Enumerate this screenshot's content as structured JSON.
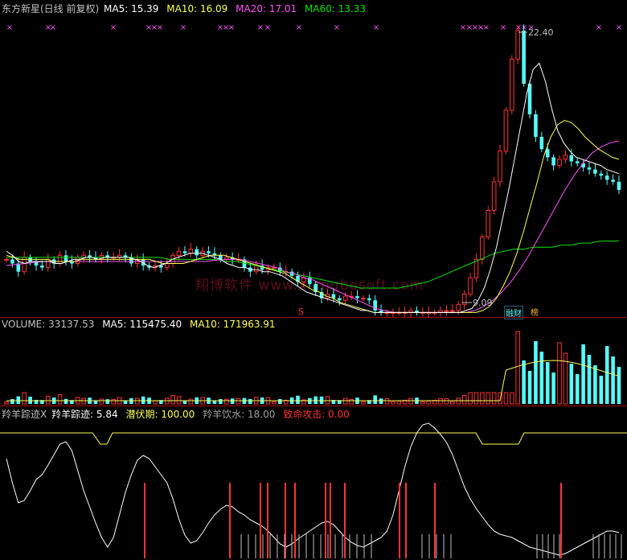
{
  "price_header": {
    "stock_name": "东方新星(日线 前复权)",
    "ma5": "MA5: 15.39",
    "ma10": "MA10: 16.09",
    "ma20": "MA20: 17.01",
    "ma60": "MA60: 13.33"
  },
  "price_panel": {
    "high_label": "22.40",
    "low_label": "9.09",
    "watermark": "翔博软件 www.xiangbosoft.com",
    "signal_mark": "S",
    "tag1": "融财",
    "tag2": "榜"
  },
  "volume_header": {
    "volume": "VOLUME: 33137.53",
    "ma5": "MA5: 115475.40",
    "ma10": "MA10: 171963.91"
  },
  "indicator_header": {
    "name": "羚羊踪迹X",
    "track": "羚羊踪迹: 5.84",
    "latent": "潜伏期: 100.00",
    "drink": "羚羊饮水: 18.00",
    "attack": "致命攻击: 0.00"
  },
  "colors": {
    "up": "#ff3232",
    "down": "#54ffff",
    "ma5": "#ffffff",
    "ma10": "#ffff54",
    "ma20": "#ff54ff",
    "ma60": "#00e600",
    "track": "#ffffff",
    "latent": "#ffff54",
    "drink": "#c0c0c0",
    "attack": "#ff3232"
  },
  "chart_data": {
    "type": "candlestick",
    "price_range": [
      9.09,
      22.4
    ],
    "close": [
      11.2,
      11.0,
      10.6,
      11.3,
      11.1,
      10.9,
      10.8,
      11.2,
      11.0,
      11.4,
      11.1,
      11.0,
      11.3,
      11.4,
      11.3,
      11.2,
      11.4,
      11.3,
      11.3,
      11.4,
      11.3,
      11.0,
      11.2,
      10.9,
      10.8,
      10.9,
      10.8,
      11.0,
      11.4,
      11.6,
      11.5,
      11.7,
      11.4,
      11.6,
      11.5,
      11.4,
      11.2,
      11.3,
      11.2,
      11.2,
      10.8,
      10.6,
      10.9,
      10.7,
      10.8,
      10.8,
      10.6,
      10.6,
      10.4,
      10.1,
      10.3,
      10.0,
      9.6,
      9.3,
      9.5,
      9.3,
      9.2,
      9.4,
      9.4,
      9.3,
      9.3,
      9.2,
      8.7,
      8.6,
      8.6,
      8.6,
      8.6,
      8.6,
      8.7,
      8.6,
      8.6,
      8.6,
      8.6,
      8.7,
      8.7,
      8.7,
      9.0,
      9.5,
      10.3,
      11.2,
      12.3,
      13.6,
      15.0,
      16.5,
      18.5,
      21.0,
      22.4,
      19.8,
      18.3,
      17.2,
      16.6,
      16.2,
      15.8,
      16.1,
      16.3,
      16.0,
      15.9,
      15.7,
      15.6,
      15.4,
      15.3,
      15.1,
      15.0,
      14.6
    ],
    "ma5": [
      11.6,
      11.4,
      11.1,
      11.0,
      11.1,
      11.1,
      11.1,
      11.1,
      11.0,
      11.0,
      11.1,
      11.2,
      11.2,
      11.3,
      11.3,
      11.2,
      11.3,
      11.3,
      11.3,
      11.3,
      11.3,
      11.2,
      11.1,
      10.9,
      10.8,
      10.9,
      11.0,
      11.2,
      11.3,
      11.4,
      11.5,
      11.5,
      11.5,
      11.4,
      11.3,
      11.2,
      11.0,
      10.9,
      10.8,
      10.8,
      10.7,
      10.7,
      10.6,
      10.6,
      10.5,
      10.4,
      10.2,
      10.0,
      9.8,
      9.6,
      9.5,
      9.4,
      9.3,
      9.2,
      9.1,
      9.0,
      8.9,
      8.8,
      8.7,
      8.7,
      8.6,
      8.6,
      8.6,
      8.6,
      8.6,
      8.6,
      8.6,
      8.6,
      8.6,
      8.6,
      8.6,
      8.6,
      8.6,
      8.6,
      8.6,
      8.7,
      8.8,
      9.2,
      9.8,
      10.7,
      11.8,
      13.2,
      14.6,
      16.2,
      17.8,
      19.4,
      20.5,
      20.8,
      19.9,
      18.6,
      17.5,
      16.9,
      16.5,
      16.2,
      16.1,
      16.0,
      15.9,
      15.8,
      15.6,
      15.5,
      15.4
    ],
    "ma10": [
      11.4,
      11.3,
      11.2,
      11.2,
      11.2,
      11.2,
      11.2,
      11.1,
      11.1,
      11.1,
      11.1,
      11.2,
      11.2,
      11.2,
      11.2,
      11.2,
      11.2,
      11.2,
      11.2,
      11.2,
      11.2,
      11.2,
      11.1,
      11.0,
      11.0,
      11.0,
      11.0,
      11.1,
      11.2,
      11.3,
      11.4,
      11.4,
      11.4,
      11.3,
      11.2,
      11.1,
      11.0,
      10.9,
      10.8,
      10.7,
      10.6,
      10.5,
      10.3,
      10.1,
      9.9,
      9.7,
      9.6,
      9.4,
      9.3,
      9.1,
      9.0,
      8.9,
      8.8,
      8.7,
      8.6,
      8.6,
      8.6,
      8.6,
      8.6,
      8.6,
      8.6,
      8.6,
      8.6,
      8.6,
      8.6,
      8.6,
      8.6,
      8.6,
      8.6,
      8.6,
      8.7,
      8.9,
      9.3,
      9.9,
      10.6,
      11.5,
      12.6,
      13.8,
      15.0,
      16.3,
      17.2,
      17.8,
      18.0,
      17.9,
      17.6,
      17.2,
      16.9,
      16.6,
      16.4,
      16.2,
      16.1
    ],
    "ma20": [
      10.9,
      10.95,
      11.0,
      11.05,
      11.1,
      11.1,
      11.1,
      11.1,
      11.1,
      11.1,
      11.1,
      11.1,
      11.1,
      11.1,
      11.1,
      11.1,
      11.1,
      11.1,
      11.1,
      11.1,
      11.1,
      11.1,
      11.1,
      11.15,
      11.2,
      11.2,
      11.2,
      11.1,
      11.0,
      10.9,
      10.8,
      10.6,
      10.5,
      10.3,
      10.2,
      10.0,
      9.8,
      9.6,
      9.4,
      9.2,
      9.0,
      8.8,
      8.7,
      8.6,
      8.6,
      8.6,
      8.6,
      8.6,
      8.6,
      8.6,
      8.6,
      8.6,
      8.7,
      8.9,
      9.2,
      9.6,
      10.1,
      10.7,
      11.4,
      12.2,
      13.0,
      13.8,
      14.6,
      15.3,
      15.9,
      16.4,
      16.7,
      16.9,
      17.0
    ],
    "ma60": [
      11.3,
      11.3,
      11.3,
      11.3,
      11.3,
      11.3,
      11.3,
      11.3,
      11.3,
      11.3,
      11.3,
      11.3,
      11.3,
      11.3,
      11.3,
      11.3,
      11.3,
      11.2,
      11.2,
      11.2,
      11.2,
      11.2,
      11.2,
      11.1,
      11.1,
      11.0,
      10.9,
      10.8,
      10.7,
      10.6,
      10.5,
      10.4,
      10.3,
      10.2,
      10.1,
      10.0,
      9.9,
      9.8,
      9.8,
      9.8,
      9.8,
      9.8,
      9.9,
      10.0,
      10.1,
      10.3,
      10.5,
      10.7,
      10.9,
      11.1,
      11.3,
      11.5,
      11.6,
      11.7,
      11.7,
      11.8,
      11.8,
      11.8,
      11.9,
      11.9,
      12.0,
      12.0,
      12.1,
      12.1,
      12.1
    ]
  }
}
